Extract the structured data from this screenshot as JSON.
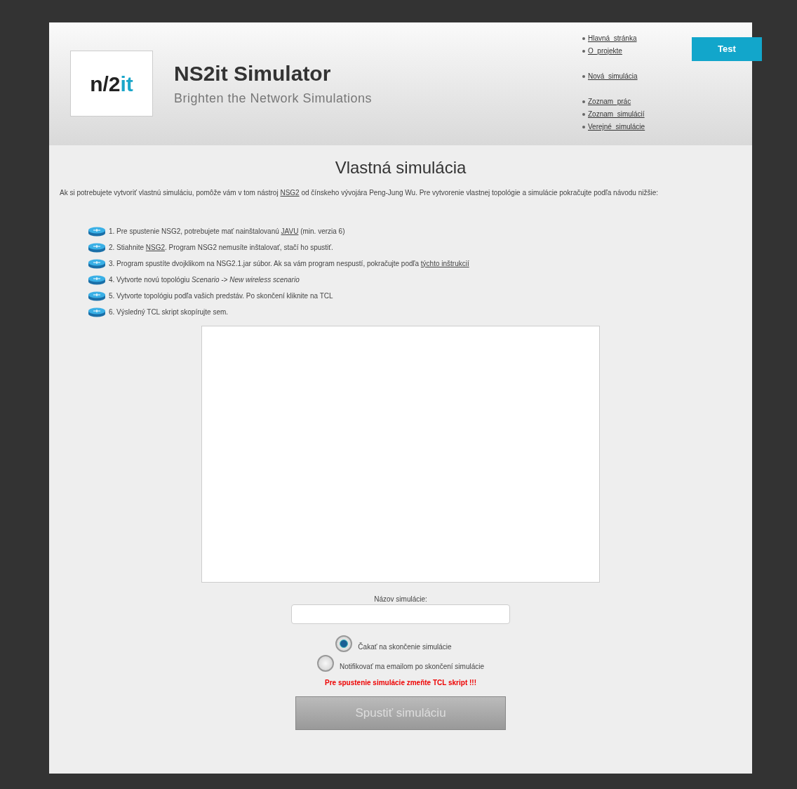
{
  "header": {
    "logo": "n/2it",
    "title": "NS2it Simulator",
    "subtitle": "Brighten the Network Simulations"
  },
  "nav_groups": [
    [
      "Hlavná_stránka",
      "O_projekte"
    ],
    [
      "Nová_simulácia"
    ],
    [
      "Zoznam_prác",
      "Zoznam_simulácií",
      "Verejné_simulácie"
    ]
  ],
  "test_button": "Test",
  "heading": "Vlastná simulácia",
  "intro": [
    {
      "kind": "text",
      "text": "Ak si potrebujete vytvoriť vlastnú simuláciu, pomôže vám v tom nástroj "
    },
    {
      "kind": "link",
      "text": "NSG2"
    },
    {
      "kind": "text",
      "text": " od čínskeho vývojára Peng-Jung Wu. Pre vytvorenie vlastnej topológie a simulácie pokračujte podľa návodu nižšie:"
    }
  ],
  "steps": [
    [
      {
        "kind": "text",
        "text": "1. Pre spustenie NSG2, potrebujete mať nainštalovanú "
      },
      {
        "kind": "link",
        "text": "JAVU"
      },
      {
        "kind": "text",
        "text": " (min. verzia 6)"
      }
    ],
    [
      {
        "kind": "text",
        "text": "2. Stiahnite "
      },
      {
        "kind": "link",
        "text": "NSG2"
      },
      {
        "kind": "text",
        "text": ". Program NSG2 nemusíte inštalovať, stačí ho spustiť."
      }
    ],
    [
      {
        "kind": "text",
        "text": "3. Program spustíte dvojklikom na NSG2.1.jar súbor. Ak sa vám program nespustí, pokračujte podľa "
      },
      {
        "kind": "link",
        "text": "týchto inštrukcií"
      }
    ],
    [
      {
        "kind": "text",
        "text": "4. Vytvorte novú topológiu "
      },
      {
        "kind": "italic",
        "text": "Scenario -> New wireless scenario"
      }
    ],
    [
      {
        "kind": "text",
        "text": "5. Vytvorte topológiu podľa vašich predstáv. Po skončení kliknite na TCL"
      }
    ],
    [
      {
        "kind": "text",
        "text": "6. Výsledný TCL skript skopírujte sem."
      }
    ]
  ],
  "name_label": "Názov simulácie:",
  "radios": [
    {
      "label": "Čakať na skončenie simulácie",
      "selected": true
    },
    {
      "label": "Notifikovať ma emailom po skončení simulácie",
      "selected": false
    }
  ],
  "warning": "Pre spustenie simulácie zmeňte TCL skript !!!",
  "submit": {
    "label": "Spustiť simuláciu",
    "disabled": true
  }
}
